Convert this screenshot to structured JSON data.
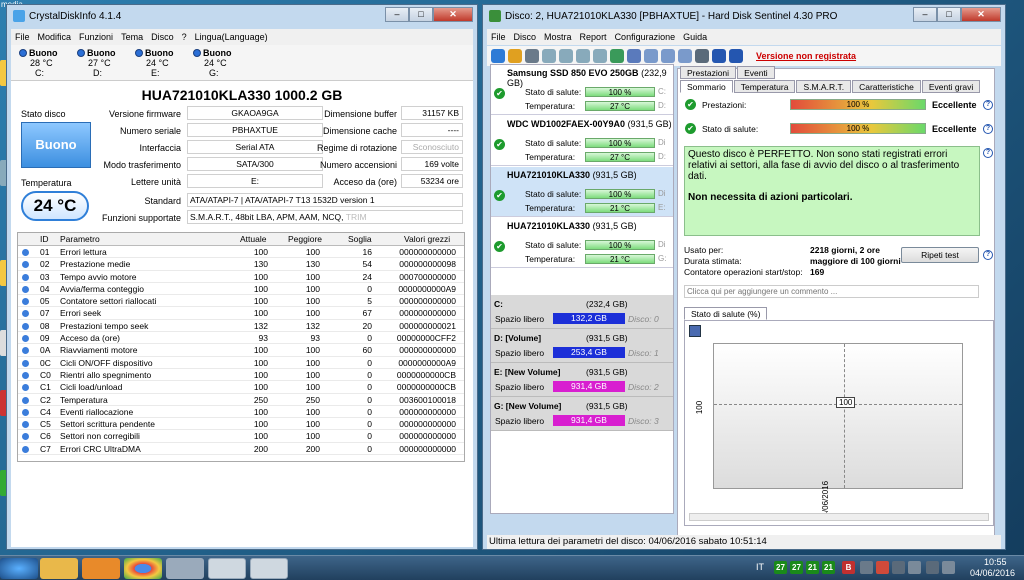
{
  "desktop": {
    "label": "media",
    "clock": {
      "time": "10:55",
      "date": "04/06/2016"
    },
    "lang": "IT",
    "tray_temps": [
      "27",
      "27",
      "21",
      "21"
    ]
  },
  "cdi": {
    "title": "CrystalDiskInfo 4.1.4",
    "menu": [
      "File",
      "Modifica",
      "Funzioni",
      "Tema",
      "Disco",
      "?",
      "Lingua(Language)"
    ],
    "drives": [
      {
        "status": "Buono",
        "temp": "28 °C",
        "letter": "C:"
      },
      {
        "status": "Buono",
        "temp": "27 °C",
        "letter": "D:"
      },
      {
        "status": "Buono",
        "temp": "24 °C",
        "letter": "E:"
      },
      {
        "status": "Buono",
        "temp": "24 °C",
        "letter": "G:"
      }
    ],
    "model": "HUA721010KLA330  1000.2 GB",
    "stato_label": "Stato disco",
    "stato_value": "Buono",
    "temp_label": "Temperatura",
    "temp_value": "24 °C",
    "fields": {
      "firmware_l": "Versione firmware",
      "firmware": "GKAOA9GA",
      "serial_l": "Numero seriale",
      "serial": "PBHAXTUE",
      "iface_l": "Interfaccia",
      "iface": "Serial ATA",
      "mode_l": "Modo trasferimento",
      "mode": "SATA/300",
      "letters_l": "Lettere unità",
      "letters": "E:",
      "standard_l": "Standard",
      "standard": "ATA/ATAPI-7 | ATA/ATAPI-7 T13 1532D version 1",
      "features_l": "Funzioni supportate",
      "features": "S.M.A.R.T., 48bit LBA, APM, AAM, NCQ,",
      "features_dim": "TRIM",
      "buffer_l": "Dimensione buffer",
      "buffer": "31157 KB",
      "cache_l": "Dimensione cache",
      "cache": "----",
      "rot_l": "Regime di rotazione",
      "rot": "Sconosciuto",
      "power_l": "Numero accensioni",
      "power": "169 volte",
      "hours_l": "Acceso da (ore)",
      "hours": "53234 ore"
    },
    "table_headers": [
      "ID",
      "Parametro",
      "Attuale",
      "Peggiore",
      "Soglia",
      "Valori grezzi"
    ],
    "rows": [
      [
        "01",
        "Errori lettura",
        "100",
        "100",
        "16",
        "000000000000"
      ],
      [
        "02",
        "Prestazione medie",
        "130",
        "130",
        "54",
        "000000000098"
      ],
      [
        "03",
        "Tempo avvio motore",
        "100",
        "100",
        "24",
        "000700000000"
      ],
      [
        "04",
        "Avvia/ferma conteggio",
        "100",
        "100",
        "0",
        "0000000000A9"
      ],
      [
        "05",
        "Contatore settori riallocati",
        "100",
        "100",
        "5",
        "000000000000"
      ],
      [
        "07",
        "Errori seek",
        "100",
        "100",
        "67",
        "000000000000"
      ],
      [
        "08",
        "Prestazioni tempo seek",
        "132",
        "132",
        "20",
        "000000000021"
      ],
      [
        "09",
        "Acceso da (ore)",
        "93",
        "93",
        "0",
        "00000000CFF2"
      ],
      [
        "0A",
        "Riavviamenti motore",
        "100",
        "100",
        "60",
        "000000000000"
      ],
      [
        "0C",
        "Cicli ON/OFF dispositivo",
        "100",
        "100",
        "0",
        "0000000000A9"
      ],
      [
        "C0",
        "Rientri allo spegnimento",
        "100",
        "100",
        "0",
        "0000000000CB"
      ],
      [
        "C1",
        "Cicli load/unload",
        "100",
        "100",
        "0",
        "0000000000CB"
      ],
      [
        "C2",
        "Temperatura",
        "250",
        "250",
        "0",
        "003600100018"
      ],
      [
        "C4",
        "Eventi riallocazione",
        "100",
        "100",
        "0",
        "000000000000"
      ],
      [
        "C5",
        "Settori scrittura pendente",
        "100",
        "100",
        "0",
        "000000000000"
      ],
      [
        "C6",
        "Settori non corregibili",
        "100",
        "100",
        "0",
        "000000000000"
      ],
      [
        "C7",
        "Errori CRC UltraDMA",
        "200",
        "200",
        "0",
        "000000000000"
      ]
    ]
  },
  "hds": {
    "title": "Disco: 2, HUA721010KLA330 [PBHAXTUE] - Hard Disk Sentinel 4.30 PRO",
    "menu": [
      "File",
      "Disco",
      "Mostra",
      "Report",
      "Configurazione",
      "Guida"
    ],
    "unregistered": "Versione non registrata",
    "disks": [
      {
        "name": "Samsung SSD 850 EVO 250GB",
        "size": "(232,9 GB)",
        "health": "100 %",
        "temp": "27 °C",
        "tail1": "C:",
        "tail2": "D:"
      },
      {
        "name": "WDC WD1002FAEX-00Y9A0",
        "size": "(931,5 GB)",
        "health": "100 %",
        "temp": "27 °C",
        "tail1": "Di",
        "tail2": "D:"
      },
      {
        "name": "HUA721010KLA330",
        "size": "(931,5 GB)",
        "health": "100 %",
        "temp": "21 °C",
        "tail1": "Di",
        "tail2": "E:"
      },
      {
        "name": "HUA721010KLA330",
        "size": "(931,5 GB)",
        "health": "100 %",
        "temp": "21 °C",
        "tail1": "Di",
        "tail2": "G:"
      }
    ],
    "health_label": "Stato di salute:",
    "temp_label": "Temperatura:",
    "partitions": [
      {
        "name": "C:",
        "size": "(232,4 GB)",
        "free": "132,2 GB",
        "disk": "Disco: 0",
        "color": "#1c2fd8"
      },
      {
        "name": "D: [Volume]",
        "size": "(931,5 GB)",
        "free": "253,4 GB",
        "disk": "Disco: 1",
        "color": "#1c2fd8"
      },
      {
        "name": "E: [New Volume]",
        "size": "(931,5 GB)",
        "free": "931,4 GB",
        "disk": "Disco: 2",
        "color": "#d81fd0"
      },
      {
        "name": "G: [New Volume]",
        "size": "(931,5 GB)",
        "free": "931,4 GB",
        "disk": "Disco: 3",
        "color": "#d81fd0"
      }
    ],
    "free_label": "Spazio libero",
    "top_tabs": [
      "Prestazioni",
      "Eventi"
    ],
    "tabs": [
      "Sommario",
      "Temperatura",
      "S.M.A.R.T.",
      "Caratteristiche",
      "Eventi gravi"
    ],
    "perf_label": "Prestazioni:",
    "perf_value": "100 %",
    "perf_text": "Eccellente",
    "health_value": "100 %",
    "health_text": "Eccellente",
    "message1": "Questo disco è PERFETTO. Non sono stati registrati errori relativi ai settori, alla fase di avvio del disco o al trasferimento dati.",
    "message2": "Non necessita di azioni particolari.",
    "used_l": "Usato per:",
    "used": "2218 giorni, 2 ore",
    "est_l": "Durata stimata:",
    "est": "maggiore di 100 giorni",
    "cnt_l": "Contatore operazioni start/stop:",
    "cnt": "169",
    "retest": "Ripeti test",
    "comment_placeholder": "Clicca qui per aggiungere un commento ...",
    "graph_tab": "Stato di salute (%)",
    "graph": {
      "y_label": "100",
      "point_label": "100",
      "x_label": "04/06/2016"
    },
    "status": "Ultima lettura dei parametri del disco: 04/06/2016 sabato 10:51:14"
  }
}
